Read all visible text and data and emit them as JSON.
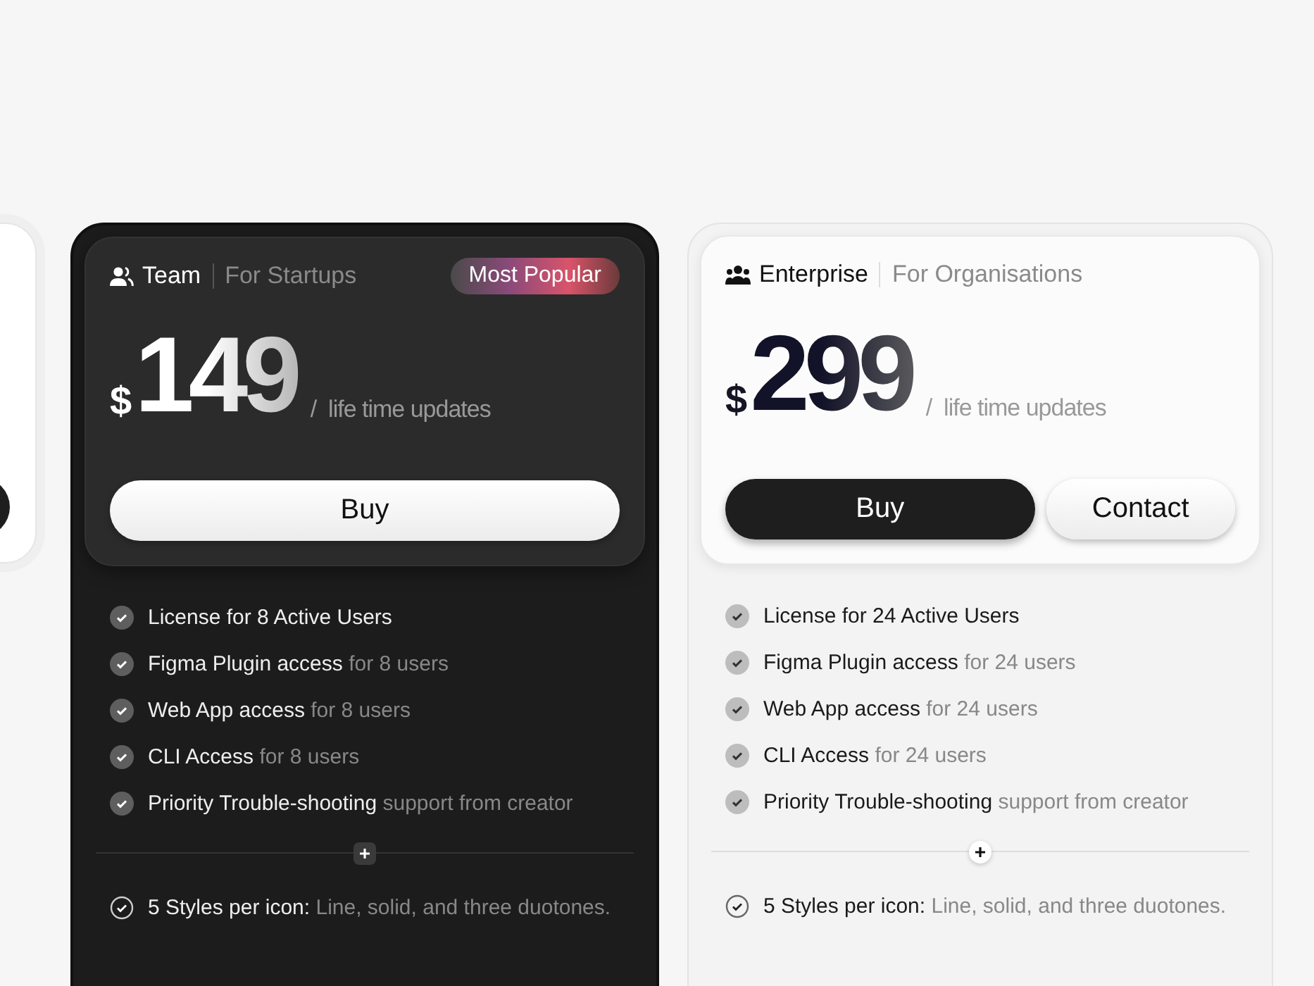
{
  "plans": [
    {
      "kind": "dark",
      "name": "Team",
      "audience": "For Startups",
      "badge": "Most Popular",
      "currency": "$",
      "price": "149",
      "period": "/  life time updates",
      "buttons": [
        {
          "kind": "light",
          "label": "Buy"
        }
      ],
      "features": [
        {
          "main": "License for 8 Active Users"
        },
        {
          "main": "Figma Plugin access",
          "note": "for 8 users"
        },
        {
          "main": "Web App access",
          "note": "for 8 users"
        },
        {
          "main": "CLI Access",
          "note": "for 8 users"
        },
        {
          "main": "Priority Trouble-shooting",
          "note": "support from creator"
        }
      ],
      "extras": [
        {
          "main": "5 Styles per icon:",
          "note": "Line, solid, and three duotones."
        }
      ]
    },
    {
      "kind": "light",
      "name": "Enterprise",
      "audience": "For Organisations",
      "currency": "$",
      "price": "299",
      "period": "/  life time updates",
      "buttons": [
        {
          "kind": "dark",
          "label": "Buy"
        },
        {
          "kind": "light",
          "label": "Contact"
        }
      ],
      "features": [
        {
          "main": "License for 24 Active Users"
        },
        {
          "main": "Figma Plugin access",
          "note": "for 24 users"
        },
        {
          "main": "Web App access",
          "note": "for 24 users"
        },
        {
          "main": "CLI Access",
          "note": "for 24 users"
        },
        {
          "main": "Priority Trouble-shooting",
          "note": "support from creator"
        }
      ],
      "extras": [
        {
          "main": "5 Styles per icon:",
          "note": "Line, solid, and three duotones."
        }
      ]
    }
  ]
}
